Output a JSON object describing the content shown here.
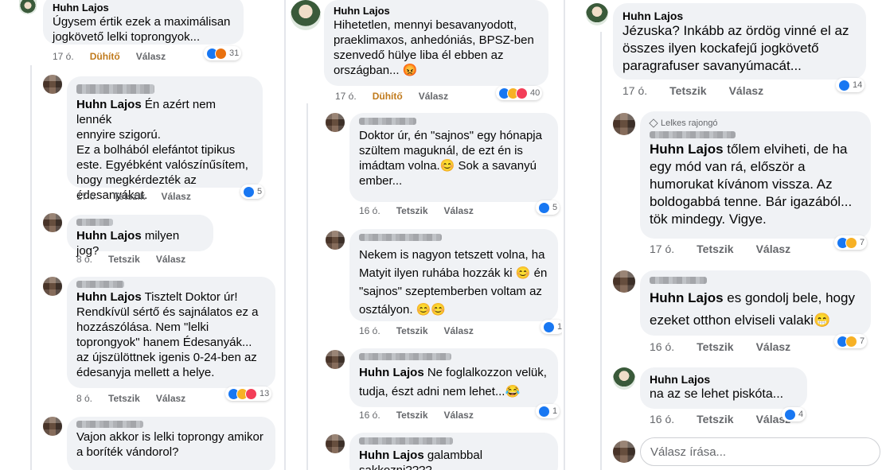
{
  "col1": {
    "c1": {
      "author": "Huhn Lajos",
      "text": "Úgysem értik ezek a maximálisan\njogkövető lelki toprongyok...",
      "time": "17 ó.",
      "reaction_label": "Dühítő",
      "reply": "Válasz",
      "count": "31"
    },
    "c2": {
      "tag": "Huhn Lajos",
      "text": " Én azért nem lennék\nennyire szigorú.\nEz a bolhából elefántot tipikus\neste. Egyébként valószínűsítem,\nhogy megkérdezték az\nédesanyákat.",
      "time": "17 ó.",
      "like": "Tetszik",
      "reply": "Válasz",
      "count": "5"
    },
    "c3": {
      "tag": "Huhn Lajos",
      "text": " milyen jog?",
      "time": "8 ó.",
      "like": "Tetszik",
      "reply": "Válasz"
    },
    "c4": {
      "tag": "Huhn Lajos",
      "text": " Tisztelt Doktor úr!\nRendkívül sértő és sajnálatos ez a\nhozzászólása. Nem \"lelki\ntoprongyok\" hanem Édesanyák...\naz újszülöttnek igenis 0-24-ben az\nédesanyja mellett a helye.",
      "time": "8 ó.",
      "like": "Tetszik",
      "reply": "Válasz",
      "count": "13"
    },
    "c5": {
      "text": "Vajon akkor is lelki toprongy amikor\na boríték vándorol?"
    }
  },
  "col2": {
    "c1": {
      "author": "Huhn Lajos",
      "text": "Hihetetlen, mennyi besavanyodott,\npraeklimaxos, anhedóniás, BPSZ-ben\nszenvedő hülye liba él ebben az\nországban... 😡",
      "time": "17 ó.",
      "reaction_label": "Dühítő",
      "reply": "Válasz",
      "count": "40"
    },
    "c2": {
      "text": "Doktor úr, én \"sajnos\" egy hónapja\nszültem maguknál, de ezt én is\nimádtam volna.😊 Sok a savanyú\nember...",
      "time": "16 ó.",
      "like": "Tetszik",
      "reply": "Válasz",
      "count": "5"
    },
    "c3": {
      "text": "Nekem is nagyon tetszett volna, ha\nMatyit ilyen ruhába hozzák ki 😊 én\n\"sajnos\" szeptemberben voltam az\nosztályon. 😊😊",
      "time": "16 ó.",
      "like": "Tetszik",
      "reply": "Válasz",
      "count": "1"
    },
    "c4": {
      "tag": "Huhn Lajos",
      "text": " Ne foglalkozzon velük,\ntudja, észt adni nem lehet...😂",
      "time": "16 ó.",
      "like": "Tetszik",
      "reply": "Válasz",
      "count": "1"
    },
    "c5": {
      "tag": "Huhn Lajos",
      "text": " galambbal sakkozni????"
    }
  },
  "col3": {
    "c1": {
      "author": "Huhn Lajos",
      "text": "Jézuska? Inkább az ördög vinné el az\nösszes ilyen kockafejű jogkövető\nparagrafuser savanyúmacát...",
      "time": "17 ó.",
      "like": "Tetszik",
      "reply": "Válasz",
      "count": "14"
    },
    "c2": {
      "badge": "Lelkes rajongó",
      "tag": "Huhn Lajos",
      "text": " tőlem elviheti, de ha\negy mód van rá, először a\nhumorukat kívánom vissza. Az\nboldogabbá tenne. Bár igazából...\ntök mindegy. Vigye.",
      "time": "17 ó.",
      "like": "Tetszik",
      "reply": "Válasz",
      "count": "7"
    },
    "c3": {
      "tag": "Huhn Lajos",
      "text": " es gondolj bele, hogy\nezeket otthon elviseli valaki😁",
      "time": "16 ó.",
      "like": "Tetszik",
      "reply": "Válasz",
      "count": "7"
    },
    "c4": {
      "author": "Huhn Lajos",
      "text": "na az se lehet piskóta...",
      "time": "16 ó.",
      "like": "Tetszik",
      "reply": "Válasz",
      "count": "4"
    },
    "reply_placeholder": "Válasz írása..."
  },
  "icons": {
    "like": "like-icon",
    "haha": "haha-icon",
    "love": "love-icon",
    "angry": "angry-icon",
    "badge": "fan-badge-icon"
  },
  "colors": {
    "like": "#1877f2",
    "haha": "#f7b125",
    "love": "#f33e58",
    "angry": "#e9710f",
    "bubble": "#f0f2f5",
    "meta": "#65676b"
  }
}
